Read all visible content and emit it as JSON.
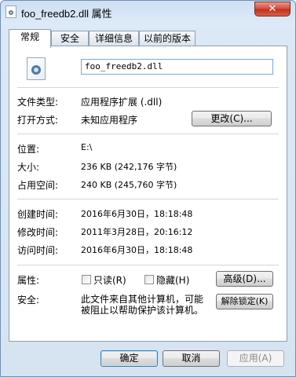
{
  "window": {
    "title": "foo_freedb2.dll 属性",
    "close_label": "✕"
  },
  "tabs": [
    "常规",
    "安全",
    "详细信息",
    "以前的版本"
  ],
  "general": {
    "file_name": "foo_freedb2.dll",
    "file_type_label": "文件类型:",
    "file_type_value": "应用程序扩展 (.dll)",
    "open_with_label": "打开方式:",
    "open_with_value": "未知应用程序",
    "change_button": "更改(C)...",
    "location_label": "位置:",
    "location_value": "E:\\",
    "size_label": "大小:",
    "size_value": "236 KB (242,176 字节)",
    "size_on_disk_label": "占用空间:",
    "size_on_disk_value": "240 KB (245,760 字节)",
    "created_label": "创建时间:",
    "created_value": "2016年6月30日，18:18:48",
    "modified_label": "修改时间:",
    "modified_value": "2011年3月28日，20:16:12",
    "accessed_label": "访问时间:",
    "accessed_value": "2016年6月30日，18:18:48",
    "attributes_label": "属性:",
    "readonly_label": "只读(R)",
    "hidden_label": "隐藏(H)",
    "advanced_button": "高级(D)...",
    "security_label": "安全:",
    "security_text_line1": "此文件来自其他计算机，可能",
    "security_text_line2": "被阻止以帮助保护该计算机。",
    "unblock_button": "解除锁定(K)"
  },
  "footer": {
    "ok": "确定",
    "cancel": "取消",
    "apply": "应用(A)"
  }
}
